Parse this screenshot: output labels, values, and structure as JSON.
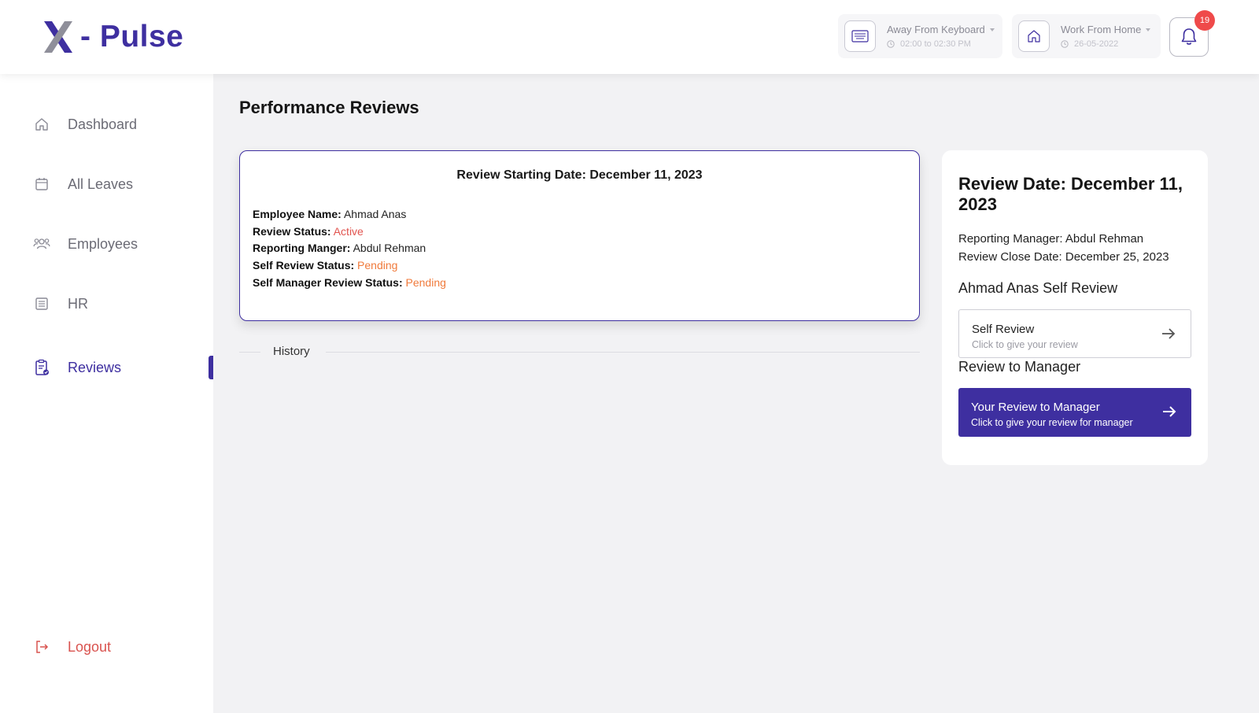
{
  "header": {
    "brand": "- Pulse",
    "status_cards": [
      {
        "title": "Away From Keyboard",
        "subtitle": "02:00 to 02:30 PM",
        "icon": "keyboard-icon"
      },
      {
        "title": "Work From Home",
        "subtitle": "26-05-2022",
        "icon": "home-icon"
      }
    ],
    "notifications_count": "19"
  },
  "sidebar": {
    "items": [
      {
        "label": "Dashboard",
        "icon": "home-icon"
      },
      {
        "label": "All Leaves",
        "icon": "calendar-icon"
      },
      {
        "label": "Employees",
        "icon": "users-icon"
      },
      {
        "label": "HR",
        "icon": "list-icon"
      },
      {
        "label": "Reviews",
        "icon": "clipboard-icon",
        "active": true
      }
    ],
    "logout": "Logout"
  },
  "main": {
    "page_title": "Performance Reviews",
    "review_card": {
      "heading": "Review Starting Date: December 11, 2023",
      "fields": [
        {
          "label": "Employee Name:",
          "value": "Ahmad Anas"
        },
        {
          "label": "Review Status:",
          "value": "Active"
        },
        {
          "label": "Reporting Manger:",
          "value": "Abdul Rehman"
        },
        {
          "label": "Self Review Status:",
          "value": "Pending"
        },
        {
          "label": "Self Manager Review Status:",
          "value": "Pending"
        }
      ]
    },
    "history_label": "History"
  },
  "side_panel": {
    "title": "Review Date: December 11, 2023",
    "reporting_manager": "Reporting Manager: Abdul Rehman",
    "close_date": "Review Close Date: December 25, 2023",
    "self_review_heading": "Ahmad Anas Self Review",
    "self_review_box": {
      "title": "Self Review",
      "subtitle": "Click to give your review"
    },
    "manager_heading": "Review to Manager",
    "manager_button": {
      "title": "Your Review to Manager",
      "subtitle": "Click to give your review for manager"
    }
  },
  "colors": {
    "brand": "#3e2fa0",
    "active_status": "#e1544f",
    "pending_status": "#f07a3b",
    "badge": "#ef4a4a",
    "logout": "#d9534f"
  }
}
